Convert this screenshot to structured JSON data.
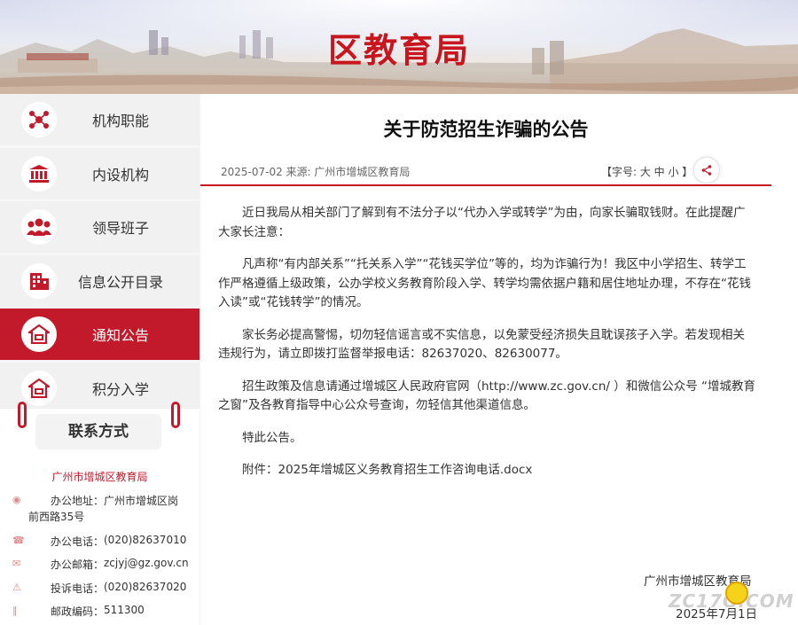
{
  "banner": {
    "title": "区教育局"
  },
  "sidebar": {
    "items": [
      {
        "label": "机构职能",
        "icon": "network-icon"
      },
      {
        "label": "内设机构",
        "icon": "building-icon"
      },
      {
        "label": "领导班子",
        "icon": "people-icon"
      },
      {
        "label": "信息公开目录",
        "icon": "office-icon"
      },
      {
        "label": "通知公告",
        "icon": "house-icon",
        "active": true
      },
      {
        "label": "积分入学",
        "icon": "house-icon"
      }
    ]
  },
  "contact": {
    "header": "联系方式",
    "org": "广州市增城区教育局",
    "rows": [
      {
        "label": "办公地址：",
        "value": "广州市增城区岗",
        "value2": "前西路35号"
      },
      {
        "label": "办公电话：",
        "value": "(020)82637010"
      },
      {
        "label": "办公邮箱：",
        "value": "zcjyj@gz.gov.cn"
      },
      {
        "label": "投诉电话：",
        "value": "(020)82637020"
      },
      {
        "label": "邮政编码：",
        "value": "511300"
      }
    ]
  },
  "article": {
    "title": "关于防范招生诈骗的公告",
    "meta": "2025-07-02 来源: 广州市增城区教育局",
    "font_size_label": "【字号: 大 中 小 】",
    "paragraphs": [
      "近日我局从相关部门了解到有不法分子以“代办入学或转学”为由，向家长骗取钱财。在此提醒广大家长注意：",
      "凡声称“有内部关系”“托关系入学”“花钱买学位”等的，均为诈骗行为！我区中小学招生、转学工作严格遵循上级政策，公办学校义务教育阶段入学、转学均需依据户籍和居住地址办理，不存在“花钱入读”或“花钱转学”的情况。",
      "家长务必提高警惕，切勿轻信谣言或不实信息，以免蒙受经济损失且耽误孩子入学。若发现相关违规行为，请立即拨打监督举报电话：82637020、82630077。",
      "招生政策及信息请通过增城区人民政府官网（http://www.zc.gov.cn/ ）和微信公众号 “增城教育之窗”及各教育指导中心公众号查询，勿轻信其他渠道信息。",
      "特此公告。"
    ],
    "attachment": "附件：2025年增城区义务教育招生工作咨询电话.docx",
    "signature_org": "广州市增城区教育局",
    "signature_date": "2025年7月1日"
  },
  "watermark": "ZC17G.COM",
  "colors": {
    "accent": "#c21a2a",
    "title_red": "#c8161e"
  }
}
